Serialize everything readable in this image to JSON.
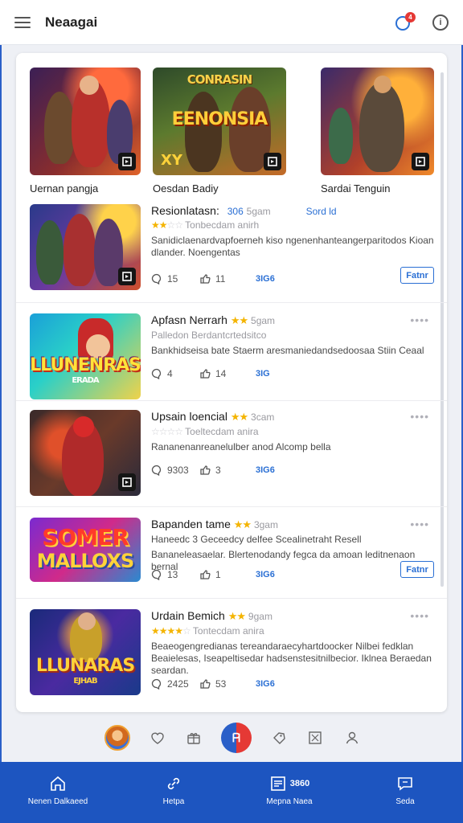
{
  "header": {
    "title": "Neaagai",
    "notification_count": "4",
    "info_glyph": "i"
  },
  "featured": [
    {
      "label": "Uernan pangja",
      "badge_icon": "play-icon"
    },
    {
      "label": "Oesdan Badiy",
      "badge_icon": "play-icon",
      "logo": "EENONSIA",
      "banner": "CONRASIN",
      "tag": "XY"
    },
    {
      "label": "Sardai Tenguin",
      "badge_icon": "play-icon"
    }
  ],
  "list": [
    {
      "title": "Resionlatasn:",
      "title_stars": "",
      "title_suffix": "306",
      "title_muted": "5gam",
      "title_link": "Sord ld",
      "rating_stars": "★★",
      "rating_off": "☆☆",
      "rating_text": "Tonbecdam anirh",
      "desc": "Sanidiclaenardvapfoerneh kiso ngenenhanteangerparitodos Kioan dlander. Noengentas",
      "replies": "15",
      "likes": "11",
      "extra": "3IG6",
      "button": "Fatnr"
    },
    {
      "title": "Apfasn Nerrarh",
      "title_stars": "★★",
      "title_muted": "5gam",
      "rating_text": "Palledon Berdantcrtedsitco",
      "desc": "Bankhidseisa bate Staerm aresmaniedandsedoosaa Stiin Ceaal",
      "replies": "4",
      "likes": "14",
      "extra": "3IG",
      "logo": "LLUNENRAS",
      "logo_sub": "ERADA"
    },
    {
      "title": "Upsain loencial",
      "title_stars": "★★",
      "title_muted": "3cam",
      "rating_stars": "",
      "rating_off": "☆☆☆☆",
      "rating_text": "Toeltecdam anira",
      "desc": "Rananenanreanelulber anod Alcomp bella",
      "replies": "9303",
      "likes": "3",
      "extra": "3IG6"
    },
    {
      "title": "Bapanden tame",
      "title_stars": "★★",
      "title_muted": "3gam",
      "rating_text": "Haneedc 3 Geceedcy delfee Scealinetraht Resell",
      "desc": "Bananeleasaelar. Blertenodandy fegca da amoan leditnenaon bernal",
      "replies": "13",
      "likes": "1",
      "extra": "3IG6",
      "button": "Fatnr",
      "logo": "SOMER",
      "logo_sub": "MALLOXS"
    },
    {
      "title": "Urdain Bemich",
      "title_stars": "★★",
      "title_muted": "9gam",
      "rating_stars": "★★★★",
      "rating_off": "☆",
      "rating_text": "Tontecdam anira",
      "desc": "Beaeogengredianas tereandaraecyhartdoocker Nilbei fedklan Beaielesas, Iseapeltisedar hadsenstesitnilbecior. Iklnea Beraedan seardan.",
      "replies": "2425",
      "likes": "53",
      "extra": "3IG6",
      "logo": "LLUNARAS",
      "logo_sub": "EJHAB"
    }
  ],
  "bottom_nav": [
    {
      "label": "Nenen Dalkaeed",
      "icon": "home-icon"
    },
    {
      "label": "Hetpa",
      "icon": "link-icon"
    },
    {
      "label": "Mepna Naea",
      "icon": "news-icon",
      "top_label": "3860"
    },
    {
      "label": "Seda",
      "icon": "chat-icon"
    }
  ],
  "colors": {
    "accent": "#2a6fd4",
    "nav_bg": "#1d55c0",
    "star": "#f4b400",
    "badge": "#e53935"
  }
}
